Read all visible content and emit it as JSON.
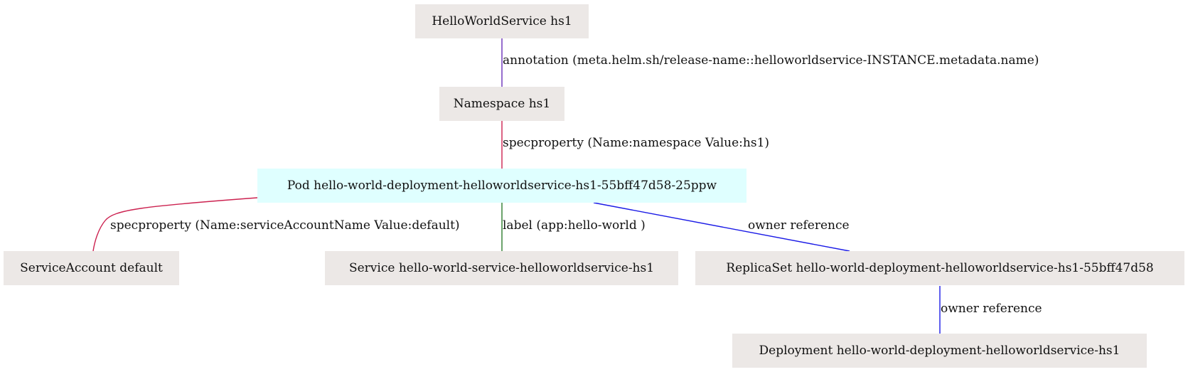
{
  "nodes": {
    "hws": {
      "label": "HelloWorldService hs1",
      "fill": "#ece8e6"
    },
    "ns": {
      "label": "Namespace hs1",
      "fill": "#ece8e6"
    },
    "pod": {
      "label": "Pod hello-world-deployment-helloworldservice-hs1-55bff47d58-25ppw",
      "fill": "#dfffff"
    },
    "sa": {
      "label": "ServiceAccount default",
      "fill": "#ece8e6"
    },
    "svc": {
      "label": "Service hello-world-service-helloworldservice-hs1",
      "fill": "#ece8e6"
    },
    "rs": {
      "label": "ReplicaSet hello-world-deployment-helloworldservice-hs1-55bff47d58",
      "fill": "#ece8e6"
    },
    "dep": {
      "label": "Deployment hello-world-deployment-helloworldservice-hs1",
      "fill": "#ece8e6"
    }
  },
  "edges": {
    "hws_ns": {
      "label": "annotation (meta.helm.sh/release-name::helloworldservice-INSTANCE.metadata.name)",
      "color": "#6a2fb8"
    },
    "ns_pod": {
      "label": "specproperty (Name:namespace Value:hs1)",
      "color": "#cc2250"
    },
    "pod_sa": {
      "label": "specproperty (Name:serviceAccountName Value:default)",
      "color": "#cc2250"
    },
    "pod_svc": {
      "label": "label (app:hello-world )",
      "color": "#2e7d2e"
    },
    "pod_rs": {
      "label": "owner reference",
      "color": "#1a1ae6"
    },
    "rs_dep": {
      "label": "owner reference",
      "color": "#1a1ae6"
    }
  }
}
